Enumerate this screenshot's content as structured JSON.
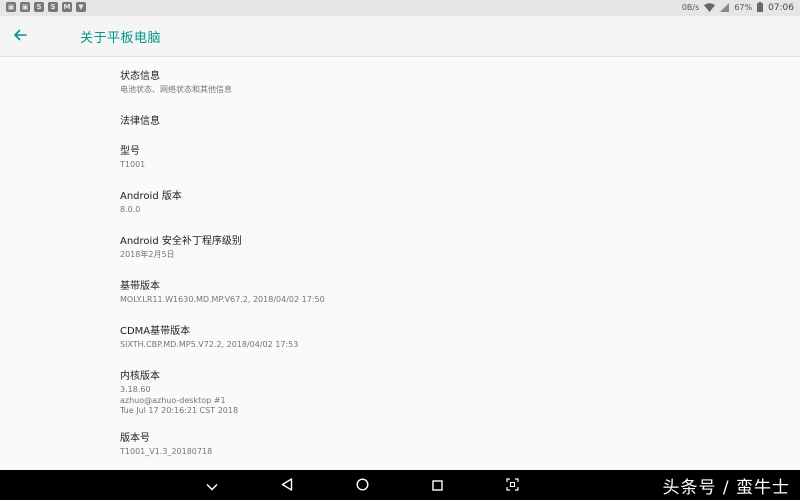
{
  "status_bar": {
    "notification_icons": [
      {
        "icon": "image-icon",
        "glyph": "▣"
      },
      {
        "icon": "image-icon",
        "glyph": "▣"
      },
      {
        "icon": "app-s-icon",
        "glyph": "S"
      },
      {
        "icon": "app-s-icon",
        "glyph": "S"
      },
      {
        "icon": "app-m-icon",
        "glyph": "M"
      },
      {
        "icon": "app-bag-icon",
        "glyph": "▼"
      }
    ],
    "net_speed": "0B/s",
    "battery": "67%",
    "time": "07:06"
  },
  "toolbar": {
    "back_icon": "arrow-left-icon",
    "title": "关于平板电脑"
  },
  "colors": {
    "accent": "#009688",
    "background": "#fafafa",
    "navbar": "#000000"
  },
  "settings": [
    {
      "name": "status-info",
      "title": "状态信息",
      "summary": "电池状态、网络状态和其他信息"
    },
    {
      "name": "legal-info",
      "title": "法律信息",
      "summary": ""
    },
    {
      "name": "model",
      "title": "型号",
      "summary": "T1001"
    },
    {
      "name": "android-version",
      "title": "Android 版本",
      "summary": "8.0.0"
    },
    {
      "name": "security-patch-level",
      "title": "Android 安全补丁程序级别",
      "summary": "2018年2月5日"
    },
    {
      "name": "baseband-version",
      "title": "基带版本",
      "summary": "MOLY.LR11.W1630.MD.MP.V67.2, 2018/04/02 17:50"
    },
    {
      "name": "cdma-baseband-version",
      "title": "CDMA基带版本",
      "summary": "SIXTH.CBP.MD.MP5.V72.2, 2018/04/02 17:53"
    },
    {
      "name": "kernel-version",
      "title": "内核版本",
      "summary": "3.18.60\nazhuo@azhuo-desktop #1\nTue Jul 17 20:16:21 CST 2018"
    },
    {
      "name": "build-number",
      "title": "版本号",
      "summary": "T1001_V1.3_20180718"
    }
  ],
  "nav_bar": {
    "buttons": [
      "chevron-down-icon",
      "back-triangle-icon",
      "home-circle-icon",
      "recents-square-icon",
      "screenshot-icon"
    ],
    "watermark": "头条号 / 蛮牛士"
  }
}
